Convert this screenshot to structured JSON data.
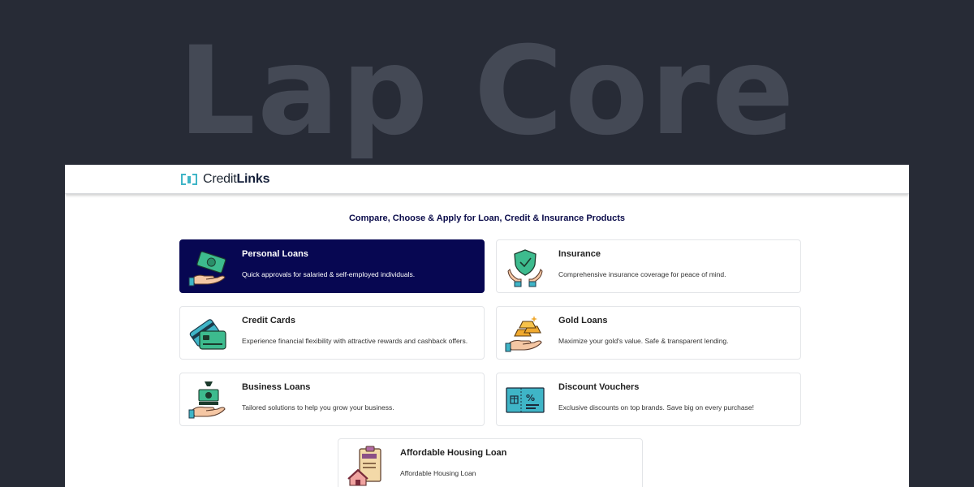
{
  "banner": {
    "title": "Lap Core"
  },
  "header": {
    "logo": {
      "brand_light": "Credit",
      "brand_bold": "Links",
      "icon": "logo-brackets-icon"
    }
  },
  "main": {
    "tagline": "Compare, Choose & Apply for Loan, Credit & Insurance Products",
    "products": [
      {
        "title": "Personal Loans",
        "description": "Quick approvals for salaried & self-employed individuals.",
        "icon": "money-hand-icon",
        "active": true
      },
      {
        "title": "Insurance",
        "description": "Comprehensive insurance coverage for peace of mind.",
        "icon": "shield-hands-icon"
      },
      {
        "title": "Credit Cards",
        "description": "Experience financial flexibility with attractive rewards and cashback offers.",
        "icon": "credit-card-icon"
      },
      {
        "title": "Gold Loans",
        "description": "Maximize your gold's value. Safe & transparent lending.",
        "icon": "gold-bars-hand-icon"
      },
      {
        "title": "Business Loans",
        "description": "Tailored solutions to help you grow your business.",
        "icon": "money-bag-hand-icon"
      },
      {
        "title": "Discount Vouchers",
        "description": "Exclusive discounts on top brands. Save big on every purchase!",
        "icon": "voucher-icon"
      },
      {
        "title": "Affordable Housing Loan",
        "description": "Affordable Housing Loan",
        "icon": "house-loan-clipboard-icon"
      }
    ]
  },
  "colors": {
    "page_background": "#272b36",
    "active_card": "#070752",
    "accent_teal": "#3fb5c7",
    "accent_green": "#3dbb8e"
  }
}
